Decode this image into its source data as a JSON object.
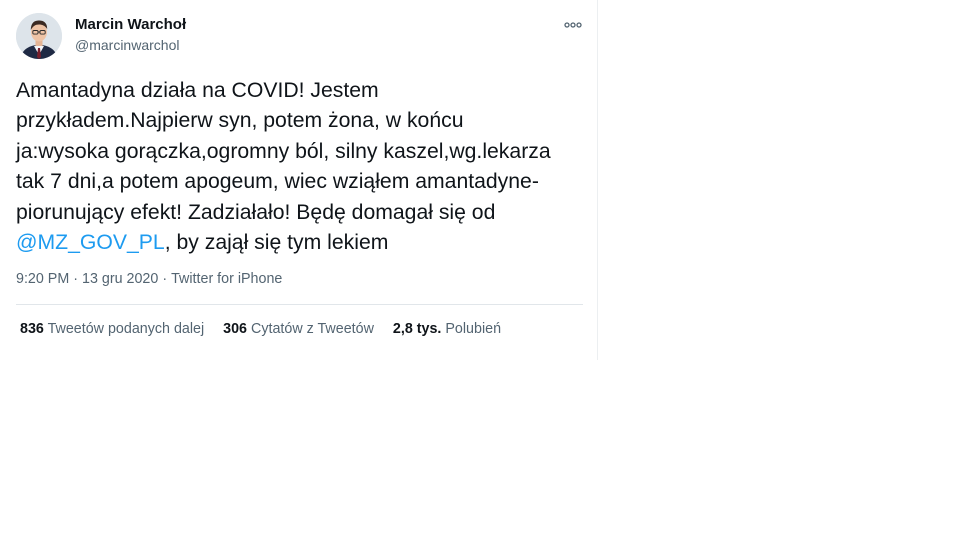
{
  "tweet": {
    "author": {
      "name": "Marcin Warchoł",
      "handle": "@marcinwarchol"
    },
    "more_icon": "more-horizontal-icon",
    "text_lines": [
      "Amantadyna działa na COVID! Jestem",
      "przykładem.Najpierw syn, potem żona, w końcu",
      "ja:wysoka gorączka,ogromny ból, silny kaszel,wg.lekarza",
      "tak 7 dni,a potem apogeum, wiec wziąłem amantadyne-",
      "piorunujący efekt! Zadziałało! Będę domagał się od"
    ],
    "mention": "@MZ_GOV_PL",
    "text_tail": ", by zajął się tym lekiem",
    "meta": {
      "time": "9:20 PM",
      "separator": "·",
      "date": "13 gru 2020",
      "source": "Twitter for iPhone"
    },
    "stats": {
      "retweets": {
        "count": "836",
        "label": "Tweetów podanych dalej"
      },
      "quotes": {
        "count": "306",
        "label": "Cytatów z Tweetów"
      },
      "likes": {
        "count": "2,8 tys.",
        "label": "Polubień"
      }
    }
  },
  "colors": {
    "text": "#0f1419",
    "secondary": "#536471",
    "link": "#1d9bf0",
    "divider": "#e1e6ea"
  }
}
